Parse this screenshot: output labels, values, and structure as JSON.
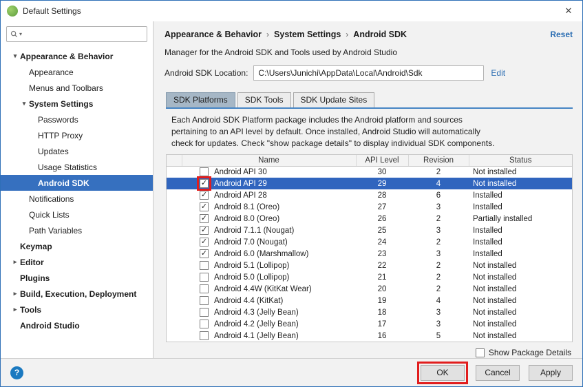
{
  "window": {
    "title": "Default Settings",
    "close_icon": "✕"
  },
  "icons": {
    "chevron_down": "▾",
    "chevron_right": "▸",
    "check": "✓",
    "search_caret": "▾",
    "help": "?"
  },
  "sidebar": {
    "search_value": "",
    "items": [
      {
        "label": "Appearance & Behavior",
        "level": 0,
        "bold": true,
        "expanded": true
      },
      {
        "label": "Appearance",
        "level": 1
      },
      {
        "label": "Menus and Toolbars",
        "level": 1
      },
      {
        "label": "System Settings",
        "level": 1,
        "bold": true,
        "expanded": true
      },
      {
        "label": "Passwords",
        "level": 2
      },
      {
        "label": "HTTP Proxy",
        "level": 2
      },
      {
        "label": "Updates",
        "level": 2
      },
      {
        "label": "Usage Statistics",
        "level": 2
      },
      {
        "label": "Android SDK",
        "level": 2,
        "selected": true
      },
      {
        "label": "Notifications",
        "level": 1
      },
      {
        "label": "Quick Lists",
        "level": 1
      },
      {
        "label": "Path Variables",
        "level": 1
      },
      {
        "label": "Keymap",
        "level": 0,
        "bold": true
      },
      {
        "label": "Editor",
        "level": 0,
        "bold": true,
        "collapsed": true
      },
      {
        "label": "Plugins",
        "level": 0,
        "bold": true
      },
      {
        "label": "Build, Execution, Deployment",
        "level": 0,
        "bold": true,
        "collapsed": true
      },
      {
        "label": "Tools",
        "level": 0,
        "bold": true,
        "collapsed": true
      },
      {
        "label": "Android Studio",
        "level": 0,
        "bold": true
      }
    ]
  },
  "header": {
    "breadcrumb": [
      "Appearance & Behavior",
      "System Settings",
      "Android SDK"
    ],
    "breadcrumb_separator": "›",
    "reset_label": "Reset",
    "description": "Manager for the Android SDK and Tools used by Android Studio",
    "sdk_location_label": "Android SDK Location:",
    "sdk_location_value": "C:\\Users\\Junichi\\AppData\\Local\\Android\\Sdk",
    "edit_label": "Edit"
  },
  "tabs": [
    {
      "label": "SDK Platforms",
      "selected": true
    },
    {
      "label": "SDK Tools",
      "selected": false
    },
    {
      "label": "SDK Update Sites",
      "selected": false
    }
  ],
  "platforms_tab": {
    "description_lines": [
      "Each Android SDK Platform package includes the Android platform and sources",
      "pertaining to an API level by default. Once installed, Android Studio will automatically",
      "check for updates. Check \"show package details\" to display individual SDK components."
    ],
    "table": {
      "columns": [
        "Name",
        "API Level",
        "Revision",
        "Status"
      ],
      "rows": [
        {
          "checked": false,
          "name": "Android API 30",
          "api_level": "30",
          "revision": "2",
          "status": "Not installed"
        },
        {
          "checked": true,
          "name": "Android API 29",
          "api_level": "29",
          "revision": "4",
          "status": "Not installed",
          "selected": true,
          "annotated": true
        },
        {
          "checked": true,
          "name": "Android API 28",
          "api_level": "28",
          "revision": "6",
          "status": "Installed"
        },
        {
          "checked": true,
          "name": "Android 8.1 (Oreo)",
          "api_level": "27",
          "revision": "3",
          "status": "Installed"
        },
        {
          "checked": true,
          "name": "Android 8.0 (Oreo)",
          "api_level": "26",
          "revision": "2",
          "status": "Partially installed"
        },
        {
          "checked": true,
          "name": "Android 7.1.1 (Nougat)",
          "api_level": "25",
          "revision": "3",
          "status": "Installed"
        },
        {
          "checked": true,
          "name": "Android 7.0 (Nougat)",
          "api_level": "24",
          "revision": "2",
          "status": "Installed"
        },
        {
          "checked": true,
          "name": "Android 6.0 (Marshmallow)",
          "api_level": "23",
          "revision": "3",
          "status": "Installed"
        },
        {
          "checked": false,
          "name": "Android 5.1 (Lollipop)",
          "api_level": "22",
          "revision": "2",
          "status": "Not installed"
        },
        {
          "checked": false,
          "name": "Android 5.0 (Lollipop)",
          "api_level": "21",
          "revision": "2",
          "status": "Not installed"
        },
        {
          "checked": false,
          "name": "Android 4.4W (KitKat Wear)",
          "api_level": "20",
          "revision": "2",
          "status": "Not installed"
        },
        {
          "checked": false,
          "name": "Android 4.4 (KitKat)",
          "api_level": "19",
          "revision": "4",
          "status": "Not installed"
        },
        {
          "checked": false,
          "name": "Android 4.3 (Jelly Bean)",
          "api_level": "18",
          "revision": "3",
          "status": "Not installed"
        },
        {
          "checked": false,
          "name": "Android 4.2 (Jelly Bean)",
          "api_level": "17",
          "revision": "3",
          "status": "Not installed"
        },
        {
          "checked": false,
          "name": "Android 4.1 (Jelly Bean)",
          "api_level": "16",
          "revision": "5",
          "status": "Not installed"
        }
      ]
    },
    "show_details_label": "Show Package Details"
  },
  "footer": {
    "ok_label": "OK",
    "cancel_label": "Cancel",
    "apply_label": "Apply"
  },
  "annotation_color": "#e11d1d"
}
